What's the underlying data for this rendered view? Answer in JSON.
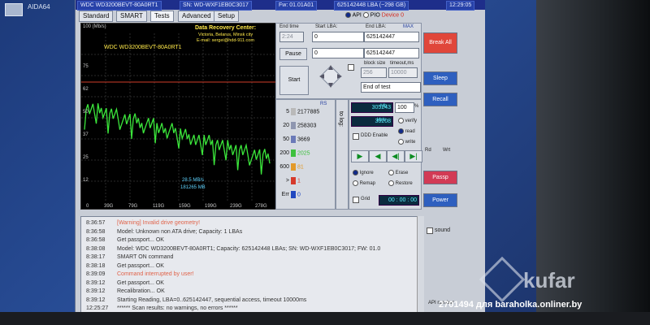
{
  "desktop": {
    "icon_label": "AIDA64"
  },
  "app": {
    "drive_model": "WDC WD3200BEVT-80A0RT1",
    "serial": "SN: WD-WXF1EB0C3017",
    "firmware": "Fw: 01.01A01",
    "lba_info": "625142448 LBA (~298 GB)",
    "clock": "12:29:05",
    "mode_api": "API",
    "mode_pio": "PIO",
    "device_label": "Device 0",
    "tabs": [
      "Standard",
      "SMART",
      "Tests",
      "Advanced",
      "Setup"
    ],
    "active_tab": "Tests"
  },
  "graph": {
    "y_top_label": "100 (Mb/s)",
    "drive_label": "WDC WD3200BEVT-80A0RT1",
    "center_title": "Data Recovery Center:",
    "center_line2": "Victoria, Belarus, Minsk city",
    "center_line3": "E-mail: sergei@hdd-911.com",
    "y_labels": [
      "75",
      "62",
      "50",
      "37",
      "25",
      "12"
    ],
    "x_labels": [
      "0",
      "39G",
      "79G",
      "119G",
      "159G",
      "199G",
      "239G",
      "278G"
    ],
    "speed_label": "28.5 MB/s",
    "pos_label": "181265 MB",
    "speed_level": [
      0.56,
      0.54,
      0.5,
      0.48,
      0.45,
      0.42,
      0.38,
      0.35,
      0.32,
      0.29,
      0.27
    ]
  },
  "controls": {
    "end_time_caption": "End time",
    "start_lba_caption": "Start LBA:",
    "end_lba_caption": "End LBA:",
    "max_caption": "MAX",
    "end_time": "2:24",
    "start_lba": "0",
    "end_lba_1": "625142447",
    "end_lba_2": "625142447",
    "pause_label": "Pause",
    "start_label": "Start",
    "start_lba_2": "0",
    "block_size_caption": "block size",
    "timeout_caption": "timeout,ms",
    "block_size": "256",
    "timeout": "10000",
    "end_action": "End of test"
  },
  "histogram": {
    "rows": [
      {
        "ms": "5",
        "count": "2177885",
        "color": "#b9b9b9"
      },
      {
        "ms": "20",
        "count": "258303",
        "color": "#8e96b0"
      },
      {
        "ms": "50",
        "count": "3669",
        "color": "#6b7ab8"
      },
      {
        "ms": "200",
        "count": "2025",
        "color": "#3ec13e"
      },
      {
        "ms": "600",
        "count": "81",
        "color": "#e39a2a"
      },
      {
        "ms": ">",
        "count": "1",
        "color": "#d63a2c"
      },
      {
        "ms": "Err",
        "count": "0",
        "color": "#2148c0"
      }
    ],
    "rs_label": "RS",
    "to_log_label": "to log:"
  },
  "stats": {
    "mb_value": "305243",
    "mb_unit": "Mb",
    "percent": "100",
    "percent_unit": "%",
    "rate_value": "30208",
    "rate_unit": "kb/s",
    "ddd_enable": "DDD Enable",
    "verify": "verify",
    "read": "read",
    "write": "write",
    "ignore": "Ignore",
    "erase": "Erase",
    "remap": "Remap",
    "restore": "Restore",
    "grid": "Grid",
    "timer": "00 : 00 : 00"
  },
  "sidebar": {
    "break_all": "Break All",
    "sleep": "Sleep",
    "recall": "Recall",
    "passp": "Passp",
    "power": "Power",
    "sound": "sound",
    "api_number": "API number",
    "label_rd": "Rd",
    "label_wrt": "Wrt"
  },
  "log": [
    {
      "time": "8:36:57",
      "msg": "[Warning] Invalid drive geometry!",
      "color": "#e0634a"
    },
    {
      "time": "8:36:58",
      "msg": "Model: Unknown non ATA drive; Capacity: 1 LBAs",
      "color": "#333333"
    },
    {
      "time": "8:36:58",
      "msg": "Get passport... OK",
      "color": "#333333"
    },
    {
      "time": "8:38:08",
      "msg": "Model: WDC WD3200BEVT-80A0RT1; Capacity: 625142448 LBAs; SN: WD-WXF1EB0C3017; FW: 01.0",
      "color": "#333333"
    },
    {
      "time": "8:38:17",
      "msg": "SMART ON command",
      "color": "#333333"
    },
    {
      "time": "8:38:18",
      "msg": "Get passport... OK",
      "color": "#333333"
    },
    {
      "time": "8:39:09",
      "msg": "Command interrupted by user!",
      "color": "#e0634a"
    },
    {
      "time": "8:39:12",
      "msg": "Get passport... OK",
      "color": "#333333"
    },
    {
      "time": "8:39:12",
      "msg": "Recalibration... OK",
      "color": "#333333"
    },
    {
      "time": "8:39:12",
      "msg": "Starting Reading, LBA=0..625142447, sequential access, timeout 10000ms",
      "color": "#333333"
    },
    {
      "time": "12:25:27",
      "msg": "****** Scan results: no warnings, no errors ******",
      "color": "#333333"
    }
  ],
  "overlay": {
    "watermark": "kufar",
    "caption": "2701494 для baraholka.onliner.by"
  }
}
